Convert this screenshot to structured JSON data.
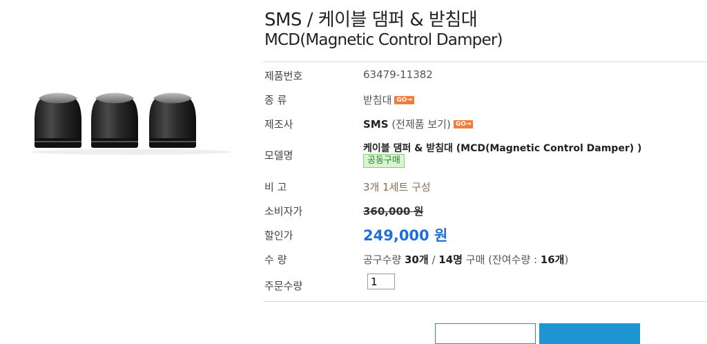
{
  "product": {
    "title": "SMS / 케이블 댐퍼 & 받침대",
    "subtitle": "MCD(Magnetic Control Damper)"
  },
  "details": {
    "product_no_label": "제품번호",
    "product_no": "63479-11382",
    "category_label": "종 류",
    "category": "받침대",
    "go_label": "GO→",
    "maker_label": "제조사",
    "maker": "SMS",
    "maker_all": "(전제품 보기)",
    "model_label": "모델명",
    "model": "케이블 댐퍼 & 받침대 (MCD(Magnetic Control Damper) )",
    "group_buy": "공동구매",
    "note_label": "비 고",
    "note": "3개 1세트 구성",
    "list_price_label": "소비자가",
    "list_price": "360,000 원",
    "sale_price_label": "할인가",
    "sale_price": "249,000 원",
    "qty_label": "수 량",
    "qty_prefix": "공구수량",
    "qty_target": "30개",
    "qty_sep": "/",
    "qty_ordered": "14명",
    "qty_buy": "구매 (잔여수량 :",
    "qty_left": "16개",
    "qty_close": ")",
    "order_qty_label": "주문수량",
    "order_qty_value": "1"
  },
  "colors": {
    "sale_price": "#1e6fd9",
    "go_badge": "#f07d3c",
    "group_badge_bg": "#d8f5cf",
    "button": "#1e94d2"
  },
  "icons": {
    "product_image": "three-black-cable-damper-cones"
  }
}
